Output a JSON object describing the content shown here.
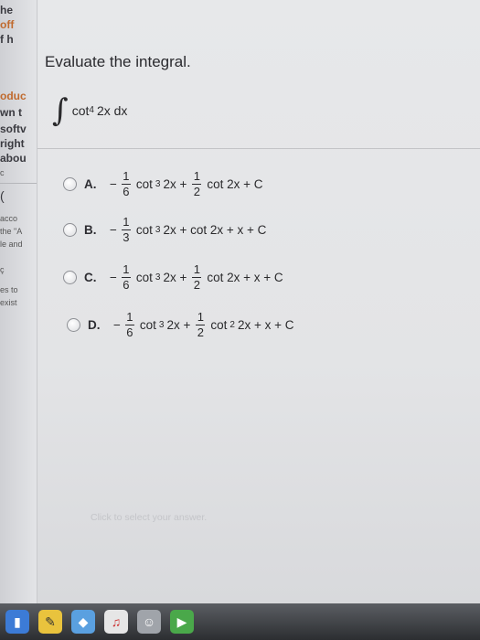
{
  "left_fragments": [
    "he",
    "off",
    "f h",
    "oduc",
    "wn t",
    "softv",
    "right",
    "abou",
    "c",
    "(",
    "acco",
    "the \"A",
    "le and",
    "ç",
    "es to",
    "exist"
  ],
  "question": {
    "title": "Evaluate the integral.",
    "integral_sign": "∫",
    "integrand": "cot",
    "power": "4",
    "arg": "2x dx"
  },
  "options": [
    {
      "letter": "A.",
      "parts": [
        {
          "sign": "−",
          "num": "1",
          "den": "6"
        },
        {
          "t": "cot"
        },
        {
          "sup": "3"
        },
        {
          "t": "2x +"
        },
        {
          "num": "1",
          "den": "2"
        },
        {
          "t": "cot 2x + C"
        }
      ]
    },
    {
      "letter": "B.",
      "parts": [
        {
          "sign": "−",
          "num": "1",
          "den": "3"
        },
        {
          "t": "cot"
        },
        {
          "sup": "3"
        },
        {
          "t": "2x + cot 2x + x + C"
        }
      ]
    },
    {
      "letter": "C.",
      "parts": [
        {
          "sign": "−",
          "num": "1",
          "den": "6"
        },
        {
          "t": "cot"
        },
        {
          "sup": "3"
        },
        {
          "t": "2x +"
        },
        {
          "num": "1",
          "den": "2"
        },
        {
          "t": "cot 2x + x + C"
        }
      ]
    },
    {
      "letter": "D.",
      "parts": [
        {
          "sign": "−",
          "num": "1",
          "den": "6"
        },
        {
          "t": "cot"
        },
        {
          "sup": "3"
        },
        {
          "t": "2x +"
        },
        {
          "num": "1",
          "den": "2"
        },
        {
          "t": "cot"
        },
        {
          "sup": "2"
        },
        {
          "t": "2x + x + C"
        }
      ]
    }
  ],
  "hint": "Click to select your answer.",
  "taskbar": [
    "chart-icon",
    "note-icon",
    "music-icon",
    "face-icon",
    "video-icon"
  ],
  "colors": {
    "panel_bg": "#e5e6e8",
    "accent": "#c06a2e"
  }
}
